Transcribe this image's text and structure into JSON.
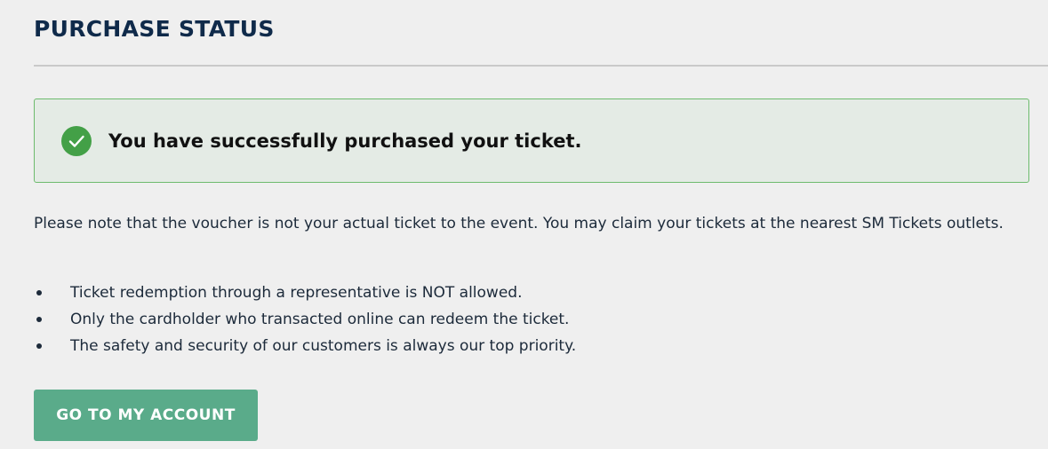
{
  "page": {
    "title": "PURCHASE STATUS"
  },
  "alert": {
    "type": "success",
    "icon": "check-circle-icon",
    "message": "You have successfully purchased your ticket."
  },
  "note": "Please note that the voucher is not your actual ticket to the event. You may claim your tickets at the nearest SM Tickets outlets.",
  "bullets": [
    "Ticket redemption through a representative is NOT allowed.",
    "Only the cardholder who transacted online can redeem the ticket.",
    "The safety and security of our customers is always our top priority."
  ],
  "actions": {
    "account_button_label": "GO TO MY ACCOUNT"
  },
  "colors": {
    "title": "#0f2a4a",
    "success_green": "#43a047",
    "alert_border": "#6dbb6d",
    "alert_background": "#e4ebe5",
    "button": "#5aab8a",
    "background": "#efefef"
  }
}
